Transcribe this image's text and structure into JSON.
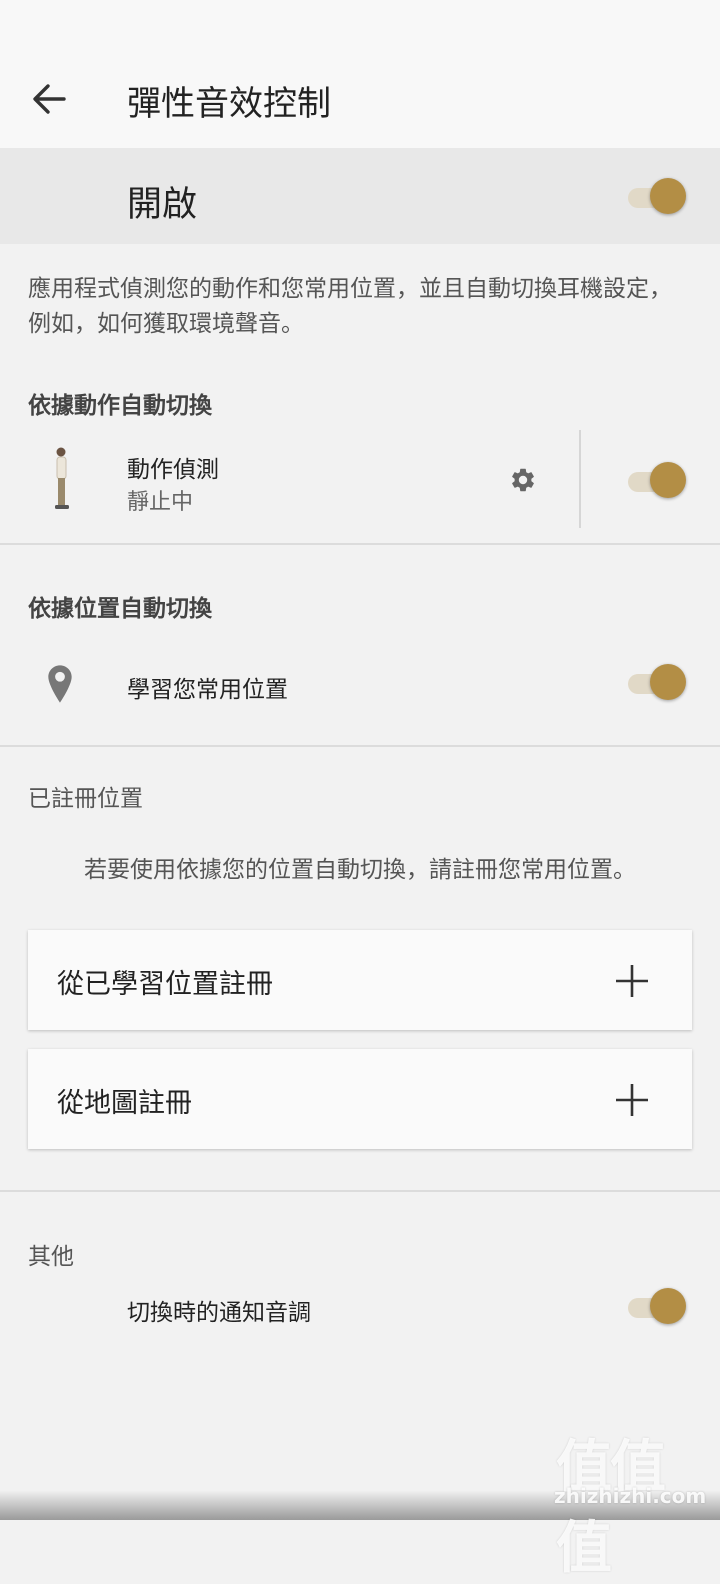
{
  "header": {
    "title": "彈性音效控制"
  },
  "master": {
    "label": "開啟",
    "toggle_on": true
  },
  "description": "應用程式偵測您的動作和您常用位置，並且自動切換耳機設定，例如，如何獲取環境聲音。",
  "motion_section": {
    "heading": "依據動作自動切換",
    "item": {
      "title": "動作偵測",
      "status": "靜止中",
      "toggle_on": true
    }
  },
  "location_section": {
    "heading": "依據位置自動切換",
    "item": {
      "title": "學習您常用位置",
      "toggle_on": true
    }
  },
  "registered_section": {
    "heading": "已註冊位置",
    "hint": "若要使用依據您的位置自動切換，請註冊您常用位置。",
    "buttons": [
      {
        "label": "從已學習位置註冊"
      },
      {
        "label": "從地圖註冊"
      }
    ]
  },
  "other_section": {
    "heading": "其他",
    "item": {
      "title": "切換時的通知音調",
      "toggle_on": true
    }
  },
  "watermark": {
    "glyphs": "值值值",
    "url": "zhizhizhi.com"
  },
  "colors": {
    "accent": "#b38e45",
    "track": "#e1d9c7"
  }
}
